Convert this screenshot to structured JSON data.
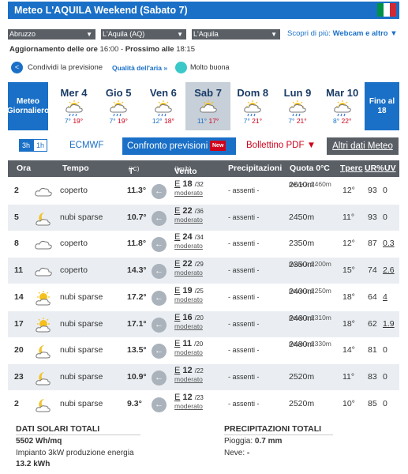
{
  "title": "Meteo L'AQUILA Weekend (Sabato 7)",
  "selects": [
    "Abruzzo",
    "L'Aquila (AQ)",
    "L'Aquila"
  ],
  "scopri": {
    "prefix": "Scopri di più: ",
    "bold": "Webcam e altro"
  },
  "aggiornamento": {
    "label1": "Aggiornamento delle ore",
    "time1": "16:00",
    "label2": "Prossimo alle",
    "time2": "18:15"
  },
  "share": {
    "label": "Condividi la previsione",
    "quality_label": "Qualità dell'aria »",
    "quality_value": "Molto buona"
  },
  "days_side_left": "Meteo Giornaliero",
  "days_side_right": "Fino al 18",
  "days": [
    {
      "name": "Mer 4",
      "icon": "rain-sun-icon",
      "min": "7°",
      "max": "19°"
    },
    {
      "name": "Gio 5",
      "icon": "rain-sun-icon",
      "min": "7°",
      "max": "19°"
    },
    {
      "name": "Ven 6",
      "icon": "rain-sun-icon",
      "min": "12°",
      "max": "18°"
    },
    {
      "name": "Sab 7",
      "icon": "cloud-sun-icon",
      "min": "11°",
      "max": "17°"
    },
    {
      "name": "Dom 8",
      "icon": "rain-sun-icon",
      "min": "7°",
      "max": "21°"
    },
    {
      "name": "Lun 9",
      "icon": "rain-sun-icon",
      "min": "7°",
      "max": "21°"
    },
    {
      "name": "Mar 10",
      "icon": "rain-sun-icon",
      "min": "8°",
      "max": "22°"
    }
  ],
  "tabs": {
    "t3h": "3h",
    "t1h": "1h",
    "ecmwf": "ECMWF",
    "confronto": "Confronto previsioni",
    "new": "New",
    "bollettino": "Bollettino PDF ▼",
    "altri": "Altri dati Meteo"
  },
  "headers": {
    "ora": "Ora",
    "tempo": "Tempo",
    "t": "T",
    "t_unit": "(°C)",
    "vento": "Vento",
    "vento_unit": "(km/h)",
    "prec": "Precipitazioni",
    "quota": "Quota 0°C",
    "tperc": "Tperc",
    "ur": "UR%",
    "uv": "UV"
  },
  "rows": [
    {
      "ora": "2",
      "icon": "cloud-icon",
      "tempo": "coperto",
      "temp": "11.3°",
      "dir": "E",
      "vel": "18",
      "raff": "32",
      "vento_desc": "moderato",
      "prec": "- assenti -",
      "quota": "2610m",
      "neve": "neve a 2460m",
      "tperc": "12°",
      "ur": "93",
      "uv": "0"
    },
    {
      "ora": "5",
      "icon": "moon-cloud-icon",
      "tempo": "nubi sparse",
      "temp": "10.7°",
      "dir": "E",
      "vel": "22",
      "raff": "36",
      "vento_desc": "moderato",
      "prec": "- assenti -",
      "quota": "2450m",
      "neve": "",
      "tperc": "11°",
      "ur": "93",
      "uv": "0"
    },
    {
      "ora": "8",
      "icon": "cloud-icon",
      "tempo": "coperto",
      "temp": "11.8°",
      "dir": "E",
      "vel": "24",
      "raff": "34",
      "vento_desc": "moderato",
      "prec": "- assenti -",
      "quota": "2350m",
      "neve": "",
      "tperc": "12°",
      "ur": "87",
      "uv": "0.3"
    },
    {
      "ora": "11",
      "icon": "cloud-icon",
      "tempo": "coperto",
      "temp": "14.3°",
      "dir": "E",
      "vel": "22",
      "raff": "29",
      "vento_desc": "moderato",
      "prec": "- assenti -",
      "quota": "2350m",
      "neve": "neve a 2200m",
      "tperc": "15°",
      "ur": "74",
      "uv": "2.6"
    },
    {
      "ora": "14",
      "icon": "sun-cloud-icon",
      "tempo": "nubi sparse",
      "temp": "17.2°",
      "dir": "E",
      "vel": "19",
      "raff": "25",
      "vento_desc": "moderato",
      "prec": "- assenti -",
      "quota": "2400m",
      "neve": "neve a 2250m",
      "tperc": "18°",
      "ur": "64",
      "uv": "4"
    },
    {
      "ora": "17",
      "icon": "sun-cloud-icon",
      "tempo": "nubi sparse",
      "temp": "17.1°",
      "dir": "E",
      "vel": "16",
      "raff": "20",
      "vento_desc": "moderato",
      "prec": "- assenti -",
      "quota": "2460m",
      "neve": "neve a 2310m",
      "tperc": "18°",
      "ur": "62",
      "uv": "1.9"
    },
    {
      "ora": "20",
      "icon": "moon-cloud-icon",
      "tempo": "nubi sparse",
      "temp": "13.5°",
      "dir": "E",
      "vel": "11",
      "raff": "20",
      "vento_desc": "moderato",
      "prec": "- assenti -",
      "quota": "2480m",
      "neve": "neve a 2330m",
      "tperc": "14°",
      "ur": "81",
      "uv": "0"
    },
    {
      "ora": "23",
      "icon": "moon-cloud-icon",
      "tempo": "nubi sparse",
      "temp": "10.9°",
      "dir": "E",
      "vel": "12",
      "raff": "22",
      "vento_desc": "moderato",
      "prec": "- assenti -",
      "quota": "2520m",
      "neve": "",
      "tperc": "11°",
      "ur": "83",
      "uv": "0"
    },
    {
      "ora": "2",
      "icon": "moon-cloud-icon",
      "tempo": "nubi sparse",
      "temp": "9.3°",
      "dir": "E",
      "vel": "12",
      "raff": "23",
      "vento_desc": "moderato",
      "prec": "- assenti -",
      "quota": "2520m",
      "neve": "",
      "tperc": "10°",
      "ur": "85",
      "uv": "0"
    }
  ],
  "footer": {
    "solar_title": "DATI SOLARI TOTALI",
    "solar_value": "5502 Wh/mq",
    "solar_desc": "Impianto 3kW produzione energia",
    "solar_energy": "13.2 kWh",
    "prec_title": "PRECIPITAZIONI TOTALI",
    "pioggia_label": "Pioggia:",
    "pioggia_value": "0.7 mm",
    "neve_label": "Neve:",
    "neve_value": "-"
  }
}
